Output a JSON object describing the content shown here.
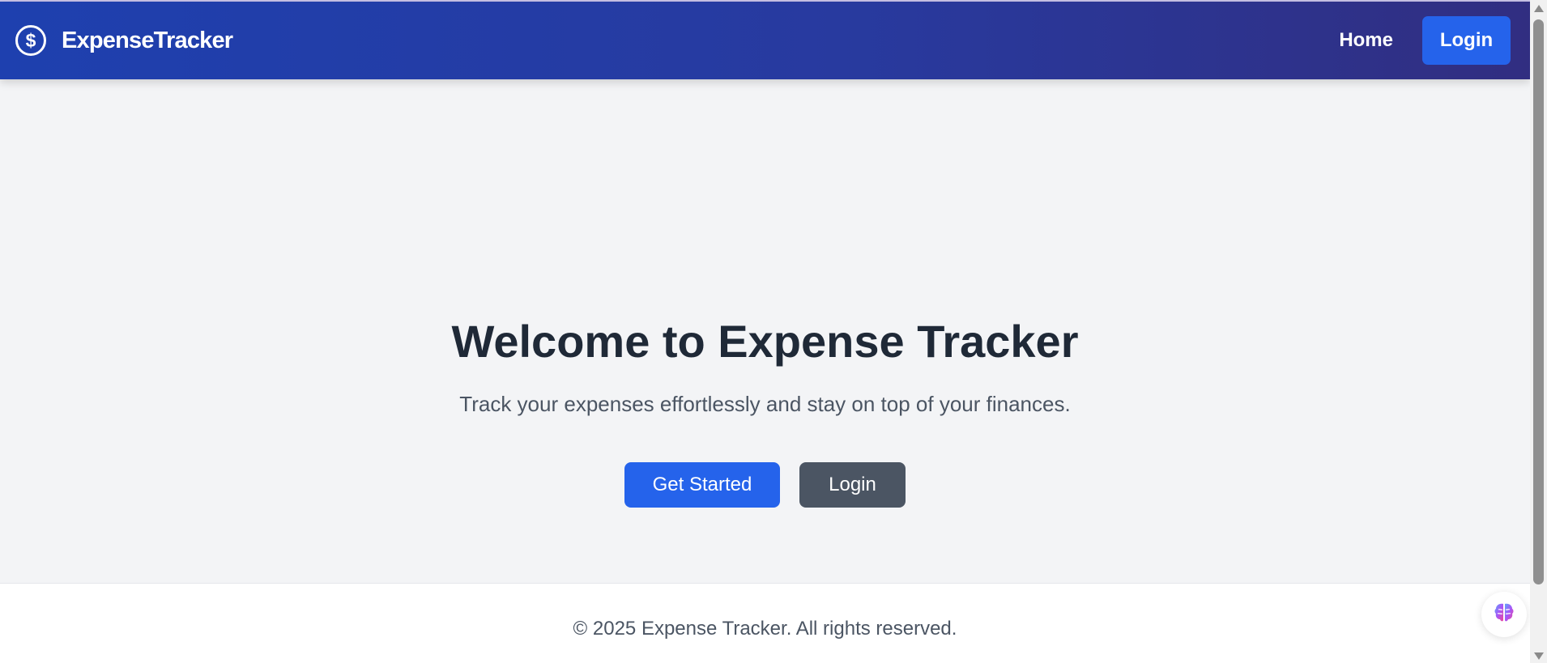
{
  "header": {
    "brand_name": "ExpenseTracker",
    "brand_icon": "dollar-circle-icon",
    "nav_home": "Home",
    "nav_login": "Login"
  },
  "hero": {
    "title": "Welcome to Expense Tracker",
    "subtitle": "Track your expenses effortlessly and stay on top of your finances.",
    "primary_button": "Get Started",
    "secondary_button": "Login"
  },
  "footer": {
    "copyright": "© 2025 Expense Tracker. All rights reserved."
  },
  "widget": {
    "icon": "brain-icon"
  },
  "colors": {
    "header_gradient_start": "#1e40af",
    "header_gradient_end": "#312e81",
    "accent": "#2563eb",
    "secondary_button": "#4b5563",
    "background": "#f3f4f6",
    "title_text": "#1f2937"
  }
}
